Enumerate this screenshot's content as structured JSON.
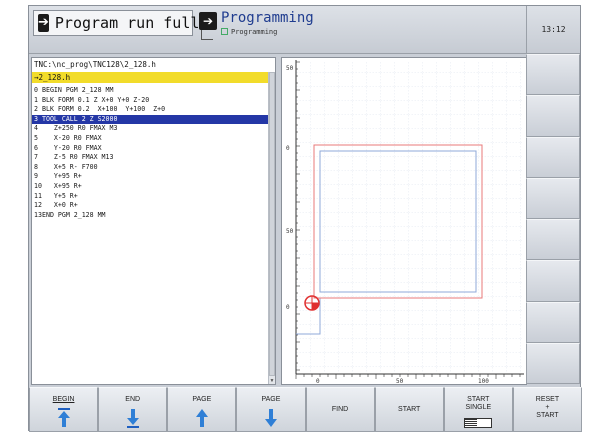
{
  "header": {
    "mode_label": "Program run full…",
    "sub_mode_title": "Programming",
    "sub_mode_small": "Programming",
    "clock": "13:12"
  },
  "program": {
    "path": "TNC:\\nc_prog\\TNC128\\2_128.h",
    "file": "→2_128.h",
    "lines": [
      {
        "n": "0",
        "text": "BEGIN PGM 2_128 MM"
      },
      {
        "n": "1",
        "text": "BLK FORM 0.1 Z X+0 Y+0 Z-20"
      },
      {
        "n": "2",
        "text": "BLK FORM 0.2  X+100  Y+100  Z+0"
      },
      {
        "n": "3",
        "text": "TOOL CALL 2 Z S2000"
      },
      {
        "n": "4",
        "text": "   Z+250 R0 FMAX M3"
      },
      {
        "n": "5",
        "text": "   X-20 R0 FMAX"
      },
      {
        "n": "6",
        "text": "   Y-20 R0 FMAX"
      },
      {
        "n": "7",
        "text": "   Z-5 R0 FMAX M13"
      },
      {
        "n": "8",
        "text": "   X+5 R- F700"
      },
      {
        "n": "9",
        "text": "   Y+95 R+"
      },
      {
        "n": "10",
        "text": "   X+95 R+"
      },
      {
        "n": "11",
        "text": "   Y+5 R+"
      },
      {
        "n": "12",
        "text": "   X+0 R+"
      },
      {
        "n": "13",
        "text": "END PGM 2_128 MM"
      }
    ],
    "selected_line": 3
  },
  "graphic": {
    "y_ticks": [
      "50",
      "0",
      "50",
      "0"
    ],
    "x_ticks": [
      "0",
      "50",
      "100"
    ],
    "colors": {
      "outer": "#e87a7a",
      "inner": "#8fa8d8",
      "tool": "#e03030"
    }
  },
  "softkeys": {
    "begin": "BEGIN",
    "end": "END",
    "page_up": "PAGE",
    "page_down": "PAGE",
    "find": "FIND",
    "start": "START",
    "start_single_1": "START",
    "start_single_2": "SINGLE",
    "reset_1": "RESET",
    "reset_2": "+",
    "reset_3": "START"
  }
}
